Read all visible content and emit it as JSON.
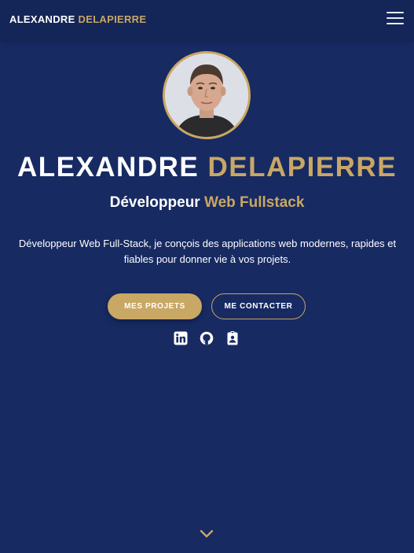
{
  "navbar": {
    "brand_first": "ALEXANDRE",
    "brand_last": "DELAPIERRE",
    "menu_icon": "hamburger-menu-icon"
  },
  "hero": {
    "name_first": "ALEXANDRE",
    "name_last": "DELAPIERRE",
    "subtitle_main": "Développeur",
    "subtitle_accent": "Web Fullstack",
    "description": "Développeur Web Full-Stack, je conçois des applications web modernes, rapides et fiables pour donner vie à vos projets.",
    "primary_button": "MES PROJETS",
    "secondary_button": "ME CONTACTER"
  },
  "social": {
    "icons": [
      "linkedin-icon",
      "github-icon",
      "contact-card-icon"
    ]
  },
  "scroll": {
    "icon": "chevron-down-icon"
  },
  "colors": {
    "background": "#172a62",
    "navbar": "#142558",
    "accent": "#c9a764",
    "text": "#ffffff"
  }
}
